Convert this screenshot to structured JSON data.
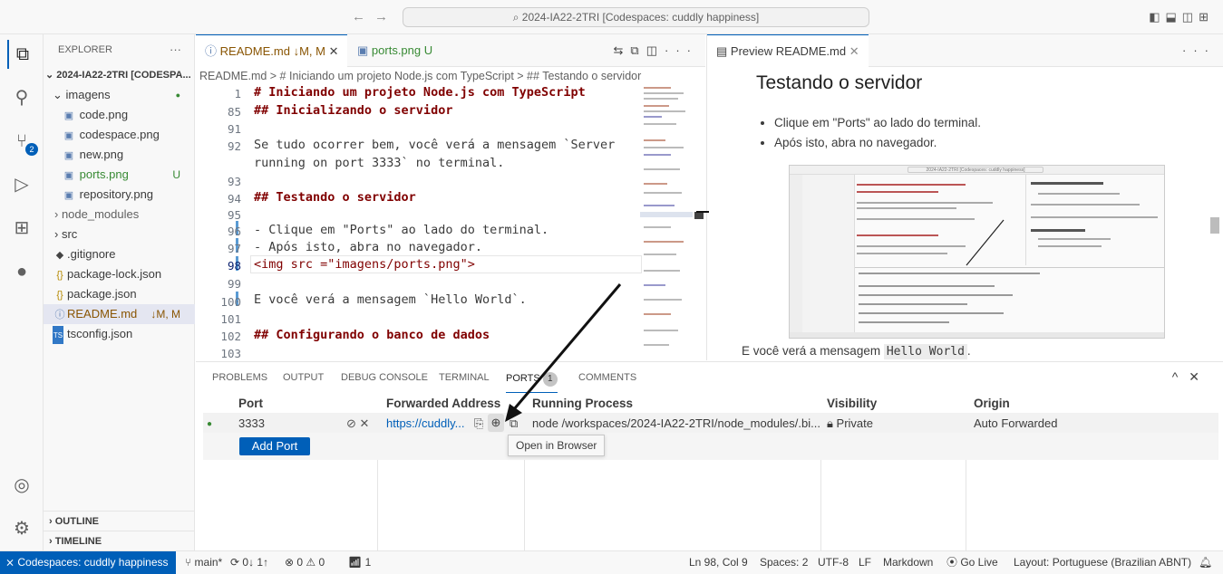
{
  "titlebar": {
    "back": "←",
    "forward": "→",
    "command_center": "2024-IA22-2TRI [Codespaces: cuddly happiness]"
  },
  "activity": [
    "explorer-icon",
    "search-icon",
    "source-control-icon",
    "run-debug-icon",
    "extensions-icon",
    "github-icon",
    "account-icon",
    "settings-gear-icon"
  ],
  "scm_badge": "2",
  "sidebar": {
    "title": "EXPLORER",
    "more": "···",
    "root": "2024-IA22-2TRI [CODESPA...",
    "items": [
      {
        "label": "imagens",
        "dec": "●",
        "kind": "folder"
      },
      {
        "label": "code.png",
        "dec": "",
        "kind": "img"
      },
      {
        "label": "codespace.png",
        "dec": "",
        "kind": "img"
      },
      {
        "label": "new.png",
        "dec": "",
        "kind": "img"
      },
      {
        "label": "ports.png",
        "dec": "U",
        "kind": "img"
      },
      {
        "label": "repository.png",
        "dec": "",
        "kind": "img"
      },
      {
        "label": "node_modules",
        "dec": "",
        "kind": "folder"
      },
      {
        "label": "src",
        "dec": "",
        "kind": "folder"
      },
      {
        "label": ".gitignore",
        "dec": "",
        "kind": "git"
      },
      {
        "label": "package-lock.json",
        "dec": "",
        "kind": "json"
      },
      {
        "label": "package.json",
        "dec": "",
        "kind": "json"
      },
      {
        "label": "README.md",
        "dec": "↓M, M",
        "kind": "md"
      },
      {
        "label": "tsconfig.json",
        "dec": "",
        "kind": "ts"
      }
    ],
    "outline": "OUTLINE",
    "timeline": "TIMELINE"
  },
  "editor1": {
    "tabs": [
      {
        "label": "README.md",
        "status": "↓M, M"
      },
      {
        "label": "ports.png",
        "status": "U"
      }
    ],
    "breadcrumb": "README.md > # Iniciando um projeto Node.js com TypeScript > ## Testando o servidor",
    "lines": [
      {
        "n": "1",
        "text": "# Iniciando um projeto Node.js com TypeScript",
        "hdr": true
      },
      {
        "n": "85",
        "text": "## Inicializando o servidor",
        "hdr": true
      },
      {
        "n": "91",
        "text": "",
        "hdr": false
      },
      {
        "n": "92",
        "text": "Se tudo ocorrer bem, você verá a mensagem `Server",
        "hdr": false
      },
      {
        "n": "",
        "text": "running on port 3333` no terminal.",
        "hdr": false
      },
      {
        "n": "93",
        "text": "",
        "hdr": false
      },
      {
        "n": "94",
        "text": "## Testando o servidor",
        "hdr": true
      },
      {
        "n": "95",
        "text": "",
        "hdr": false
      },
      {
        "n": "96",
        "text": "- Clique em \"Ports\" ao lado do terminal.",
        "hdr": false
      },
      {
        "n": "97",
        "text": "- Após isto, abra no navegador.",
        "hdr": false
      },
      {
        "n": "98",
        "text": "<img src =\"imagens/ports.png\">",
        "hdr": false
      },
      {
        "n": "99",
        "text": "",
        "hdr": false
      },
      {
        "n": "100",
        "text": " E você verá a mensagem `Hello World`.",
        "hdr": false
      },
      {
        "n": "101",
        "text": "",
        "hdr": false
      },
      {
        "n": "102",
        "text": "## Configurando o banco de dados",
        "hdr": true
      },
      {
        "n": "103",
        "text": "",
        "hdr": false
      }
    ]
  },
  "preview": {
    "tab": "Preview README.md",
    "more": "···",
    "heading": "Testando o servidor",
    "bullets": [
      "Clique em \"Ports\" ao lado do terminal.",
      "Após isto, abra no navegador."
    ],
    "after_prefix": "E você verá a mensagem ",
    "after_code": "Hello World",
    "after_suffix": ".",
    "image_caption": "2024-IA22-2TRI [Codespaces: cuddly happiness]"
  },
  "panel": {
    "tabs": [
      "PROBLEMS",
      "OUTPUT",
      "DEBUG CONSOLE",
      "TERMINAL",
      "PORTS",
      "COMMENTS"
    ],
    "ports_count": "1",
    "columns": [
      "Port",
      "Forwarded Address",
      "Running Process",
      "Visibility",
      "Origin"
    ],
    "row": {
      "port": "3333",
      "address": "https://cuddly...",
      "process": "node /workspaces/2024-IA22-2TRI/node_modules/.bi...",
      "visibility": "Private",
      "origin": "Auto Forwarded"
    },
    "add_port": "Add Port",
    "tooltip": "Open in Browser"
  },
  "status": {
    "remote": "Codespaces: cuddly happiness",
    "branch": "main*",
    "sync": "0↓ 1↑",
    "problems": "⊗ 0 ⚠ 0",
    "ports": "1",
    "position": "Ln 98, Col 9",
    "spaces": "Spaces: 2",
    "encoding": "UTF-8",
    "eol": "LF",
    "language": "Markdown",
    "golive": "Go Live",
    "layout": "Layout: Portuguese (Brazilian ABNT)"
  }
}
